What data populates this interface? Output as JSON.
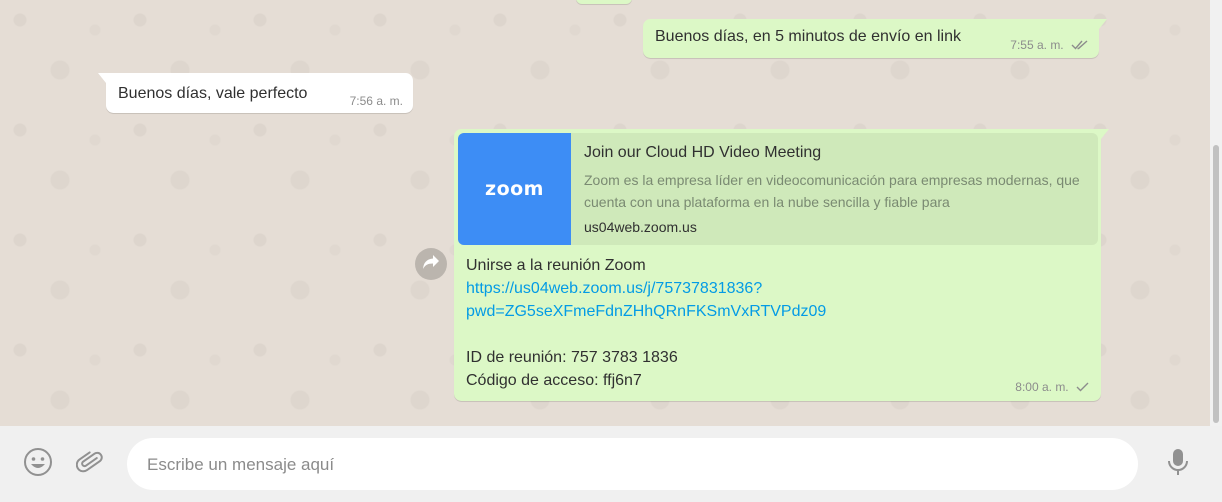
{
  "chat": {
    "messages": [
      {
        "direction": "outgoing",
        "text": "Buenos días, en 5 minutos de envío en link",
        "time": "7:55 a. m.",
        "status": "read"
      },
      {
        "direction": "incoming",
        "text": "Buenos días, vale perfecto",
        "time": "7:56 a. m."
      },
      {
        "direction": "outgoing",
        "preview": {
          "logo": "zoom",
          "title": "Join our Cloud HD Video Meeting",
          "description": "Zoom es la empresa líder en videocomunicación para empresas modernas, que cuenta con una plataforma en la nube sencilla y fiable para",
          "domain": "us04web.zoom.us"
        },
        "line1": "Unirse a la reunión Zoom",
        "link_line1": "https://us04web.zoom.us/j/75737831836?",
        "link_line2": "pwd=ZG5seXFmeFdnZHhQRnFKSmVxRTVPdz09",
        "meeting_id": "ID de reunión: 757 3783 1836",
        "access_code": "Código de acceso: ffj6n7",
        "time": "8:00 a. m.",
        "status": "sent"
      }
    ]
  },
  "composer": {
    "placeholder": "Escribe un mensaje aquí",
    "emoji_icon": "emoji-icon",
    "attach_icon": "paperclip-icon",
    "mic_icon": "microphone-icon"
  },
  "colors": {
    "outgoing_bubble": "#dcf8c6",
    "incoming_bubble": "#ffffff",
    "link": "#039be5",
    "read_tick": "#4fc3f7",
    "background": "#e5ddd5"
  }
}
